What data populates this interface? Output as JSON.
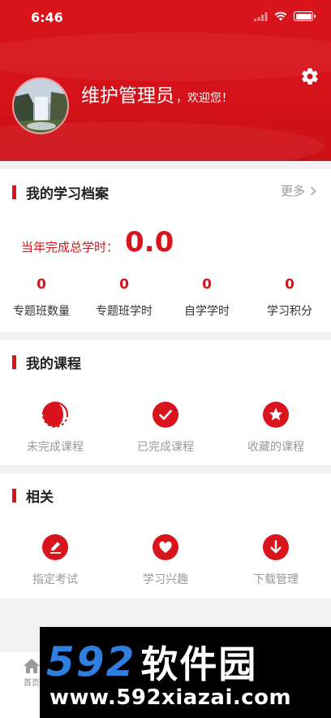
{
  "status_bar": {
    "time": "6:46"
  },
  "header": {
    "user_name": "维护管理员",
    "greeting": "，欢迎您！"
  },
  "archive": {
    "title": "我的学习档案",
    "more_label": "更多",
    "total_label": "当年完成总学时：",
    "total_value": "0.0",
    "stats": [
      {
        "value": "0",
        "label": "专题班数量"
      },
      {
        "value": "0",
        "label": "专题班学时"
      },
      {
        "value": "0",
        "label": "自学学时"
      },
      {
        "value": "0",
        "label": "学习积分"
      }
    ]
  },
  "courses": {
    "title": "我的课程",
    "items": [
      {
        "label": "未完成课程",
        "icon": "half-circle-icon"
      },
      {
        "label": "已完成课程",
        "icon": "check-icon"
      },
      {
        "label": "收藏的课程",
        "icon": "star-icon"
      }
    ]
  },
  "related": {
    "title": "相关",
    "items": [
      {
        "label": "指定考试",
        "icon": "pen-icon"
      },
      {
        "label": "学习兴趣",
        "icon": "heart-icon"
      },
      {
        "label": "下载管理",
        "icon": "download-icon"
      }
    ]
  },
  "tabbar": {
    "home_label": "首页"
  },
  "watermark": {
    "number": "592",
    "brand": "软件园",
    "url": "www.592xiazai.com"
  },
  "colors": {
    "accent": "#d8141c",
    "muted": "#999999"
  }
}
